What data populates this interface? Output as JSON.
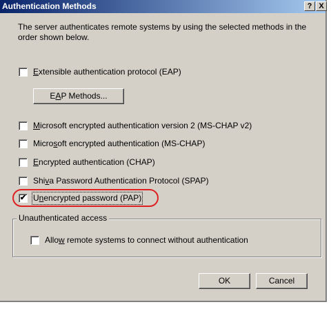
{
  "window": {
    "title": "Authentication Methods",
    "help_label": "?",
    "close_label": "X"
  },
  "description": "The server authenticates remote systems by using the selected methods in the order shown below.",
  "methods": [
    {
      "pre": "",
      "key": "E",
      "post": "xtensible authentication protocol (EAP)",
      "checked": false
    },
    {
      "pre": "",
      "key": "M",
      "post": "icrosoft encrypted authentication version 2 (MS-CHAP v2)",
      "checked": false
    },
    {
      "pre": "Micro",
      "key": "s",
      "post": "oft encrypted authentication (MS-CHAP)",
      "checked": false
    },
    {
      "pre": "",
      "key": "E",
      "post": "ncrypted authentication (CHAP)",
      "checked": false
    },
    {
      "pre": "Shi",
      "key": "v",
      "post": "a Password Authentication Protocol (SPAP)",
      "checked": false
    },
    {
      "pre": "U",
      "key": "n",
      "post": "encrypted password (PAP)",
      "checked": true
    }
  ],
  "eap_button": {
    "pre": "E",
    "key": "A",
    "post": "P Methods..."
  },
  "unauth_group": {
    "legend": "Unauthenticated access",
    "checkbox": {
      "pre": "Allo",
      "key": "w",
      "post": " remote systems to connect without authentication",
      "checked": false
    }
  },
  "footer": {
    "ok_label": "OK",
    "cancel_label": "Cancel"
  },
  "check_glyph": "✔"
}
